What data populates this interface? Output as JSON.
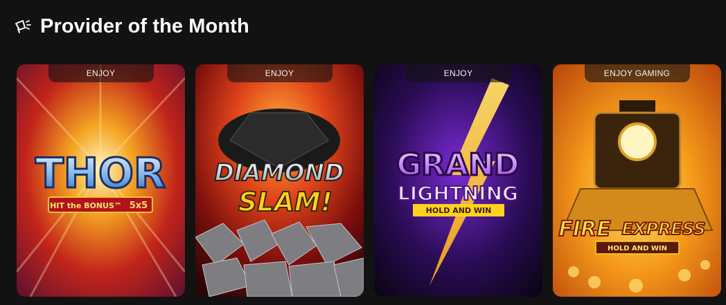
{
  "header": {
    "title": "Provider of the Month",
    "icon": "megaphone-icon"
  },
  "games": [
    {
      "provider": "ENJOY",
      "logo_main": "THOR",
      "logo_badge_left": "HIT the BONUS™",
      "logo_badge_right": "5x5",
      "colors": {
        "bg1": "#f5a623",
        "bg2": "#c2241a",
        "bg3": "#5a1030"
      }
    },
    {
      "provider": "ENJOY",
      "logo_line1": "DIAMOND",
      "logo_line2": "SLAM!",
      "colors": {
        "bg1": "#ff7a1a",
        "bg2": "#a0140f",
        "bg3": "#2a0606"
      }
    },
    {
      "provider": "ENJOY",
      "logo_line1": "GRAND",
      "logo_line2": "LIGHTNING",
      "logo_badge": "HOLD AND WIN",
      "colors": {
        "bg1": "#7b2ad6",
        "bg2": "#2a0c55",
        "bg3": "#08040f"
      }
    },
    {
      "provider": "ENJOY GAMING",
      "logo_line1": "FIRE",
      "logo_line2": "EXPRESS",
      "logo_badge": "HOLD AND WIN",
      "colors": {
        "bg1": "#ffd23a",
        "bg2": "#f07a10",
        "bg3": "#b8420a"
      }
    }
  ]
}
